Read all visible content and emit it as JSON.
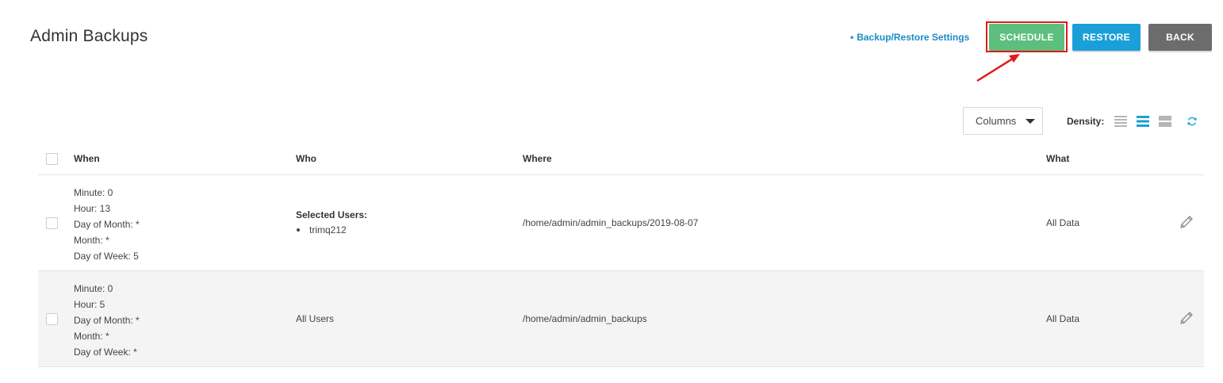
{
  "header": {
    "title": "Admin Backups",
    "settings_link_bullet": "•",
    "settings_link": "Backup/Restore Settings",
    "buttons": {
      "schedule": "SCHEDULE",
      "restore": "RESTORE",
      "back": "BACK"
    }
  },
  "toolbar": {
    "columns_label": "Columns",
    "density_label": "Density:",
    "density_options": [
      "compact-icon",
      "default-icon",
      "comfortable-icon"
    ],
    "selected_density": "default-icon"
  },
  "table": {
    "columns": [
      "When",
      "Who",
      "Where",
      "What"
    ],
    "rows": [
      {
        "when": [
          "Minute: 0",
          "Hour: 13",
          "Day of Month: *",
          "Month: *",
          "Day of Week: 5"
        ],
        "who_title": "Selected Users:",
        "who_users": [
          "trimq212"
        ],
        "where": "/home/admin/admin_backups/2019-08-07",
        "what": "All Data"
      },
      {
        "when": [
          "Minute: 0",
          "Hour: 5",
          "Day of Month: *",
          "Month: *",
          "Day of Week: *"
        ],
        "who": "All Users",
        "where": "/home/admin/admin_backups",
        "what": "All Data"
      }
    ]
  },
  "colors": {
    "schedule": "#5cbf7d",
    "restore": "#1a9fd9",
    "back": "#6c6c6c",
    "link": "#1b8bc7",
    "highlight": "#e01b1b"
  }
}
